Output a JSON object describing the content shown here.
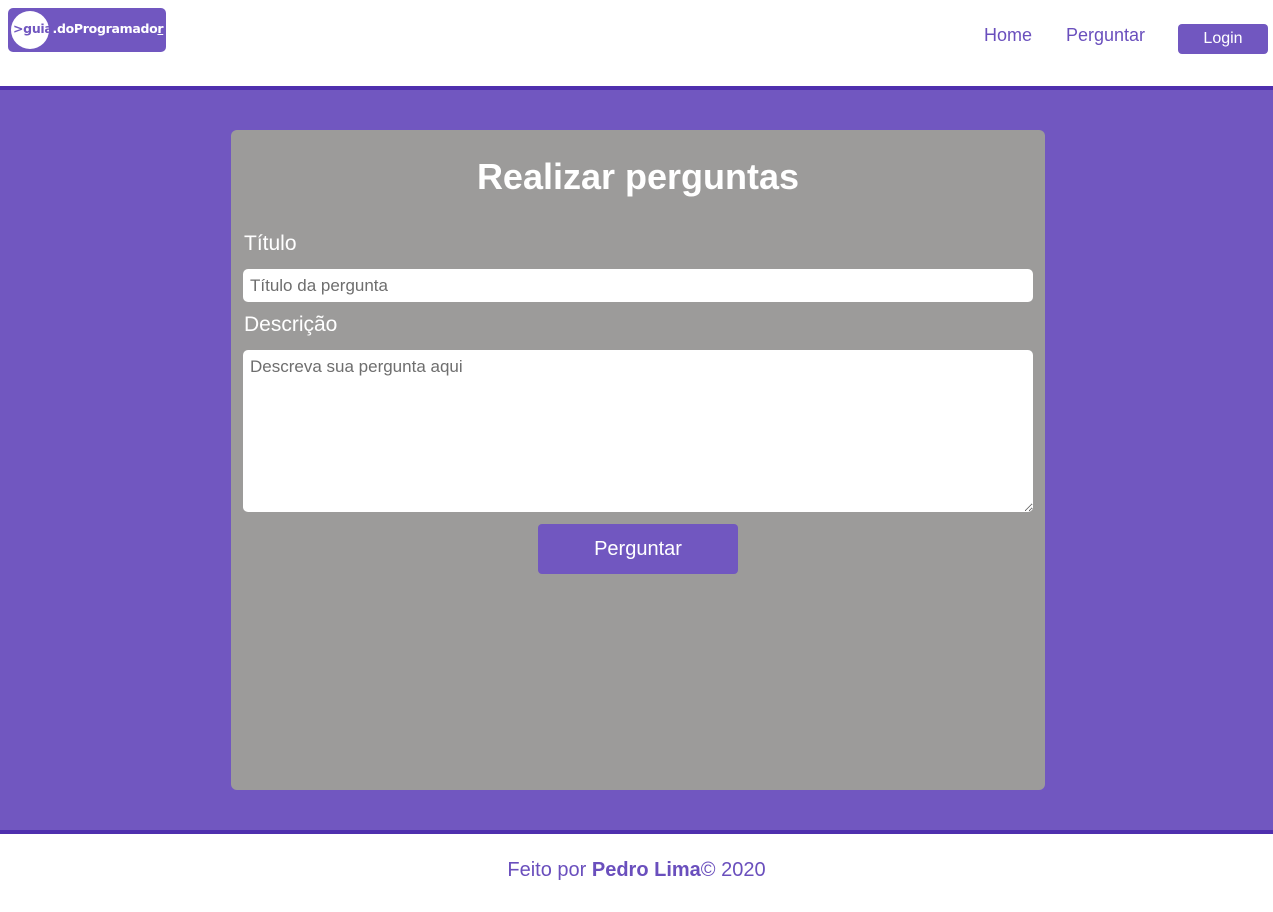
{
  "header": {
    "logo": {
      "prefix": ">guia",
      "middle": ".doProgramado",
      "cursor": "r"
    },
    "nav": {
      "home": "Home",
      "ask": "Perguntar",
      "login": "Login"
    }
  },
  "form": {
    "title": "Realizar perguntas",
    "title_label": "Título",
    "title_placeholder": "Título da pergunta",
    "description_label": "Descrição",
    "description_placeholder": "Descreva sua pergunta aqui",
    "submit_label": "Perguntar"
  },
  "footer": {
    "prefix": "Feito por ",
    "author": "Pedro Lima",
    "suffix": "© 2020"
  },
  "colors": {
    "brand": "#7157c0",
    "border": "#4f2fae",
    "card": "#9c9b9a",
    "link": "#6a4fbd"
  }
}
